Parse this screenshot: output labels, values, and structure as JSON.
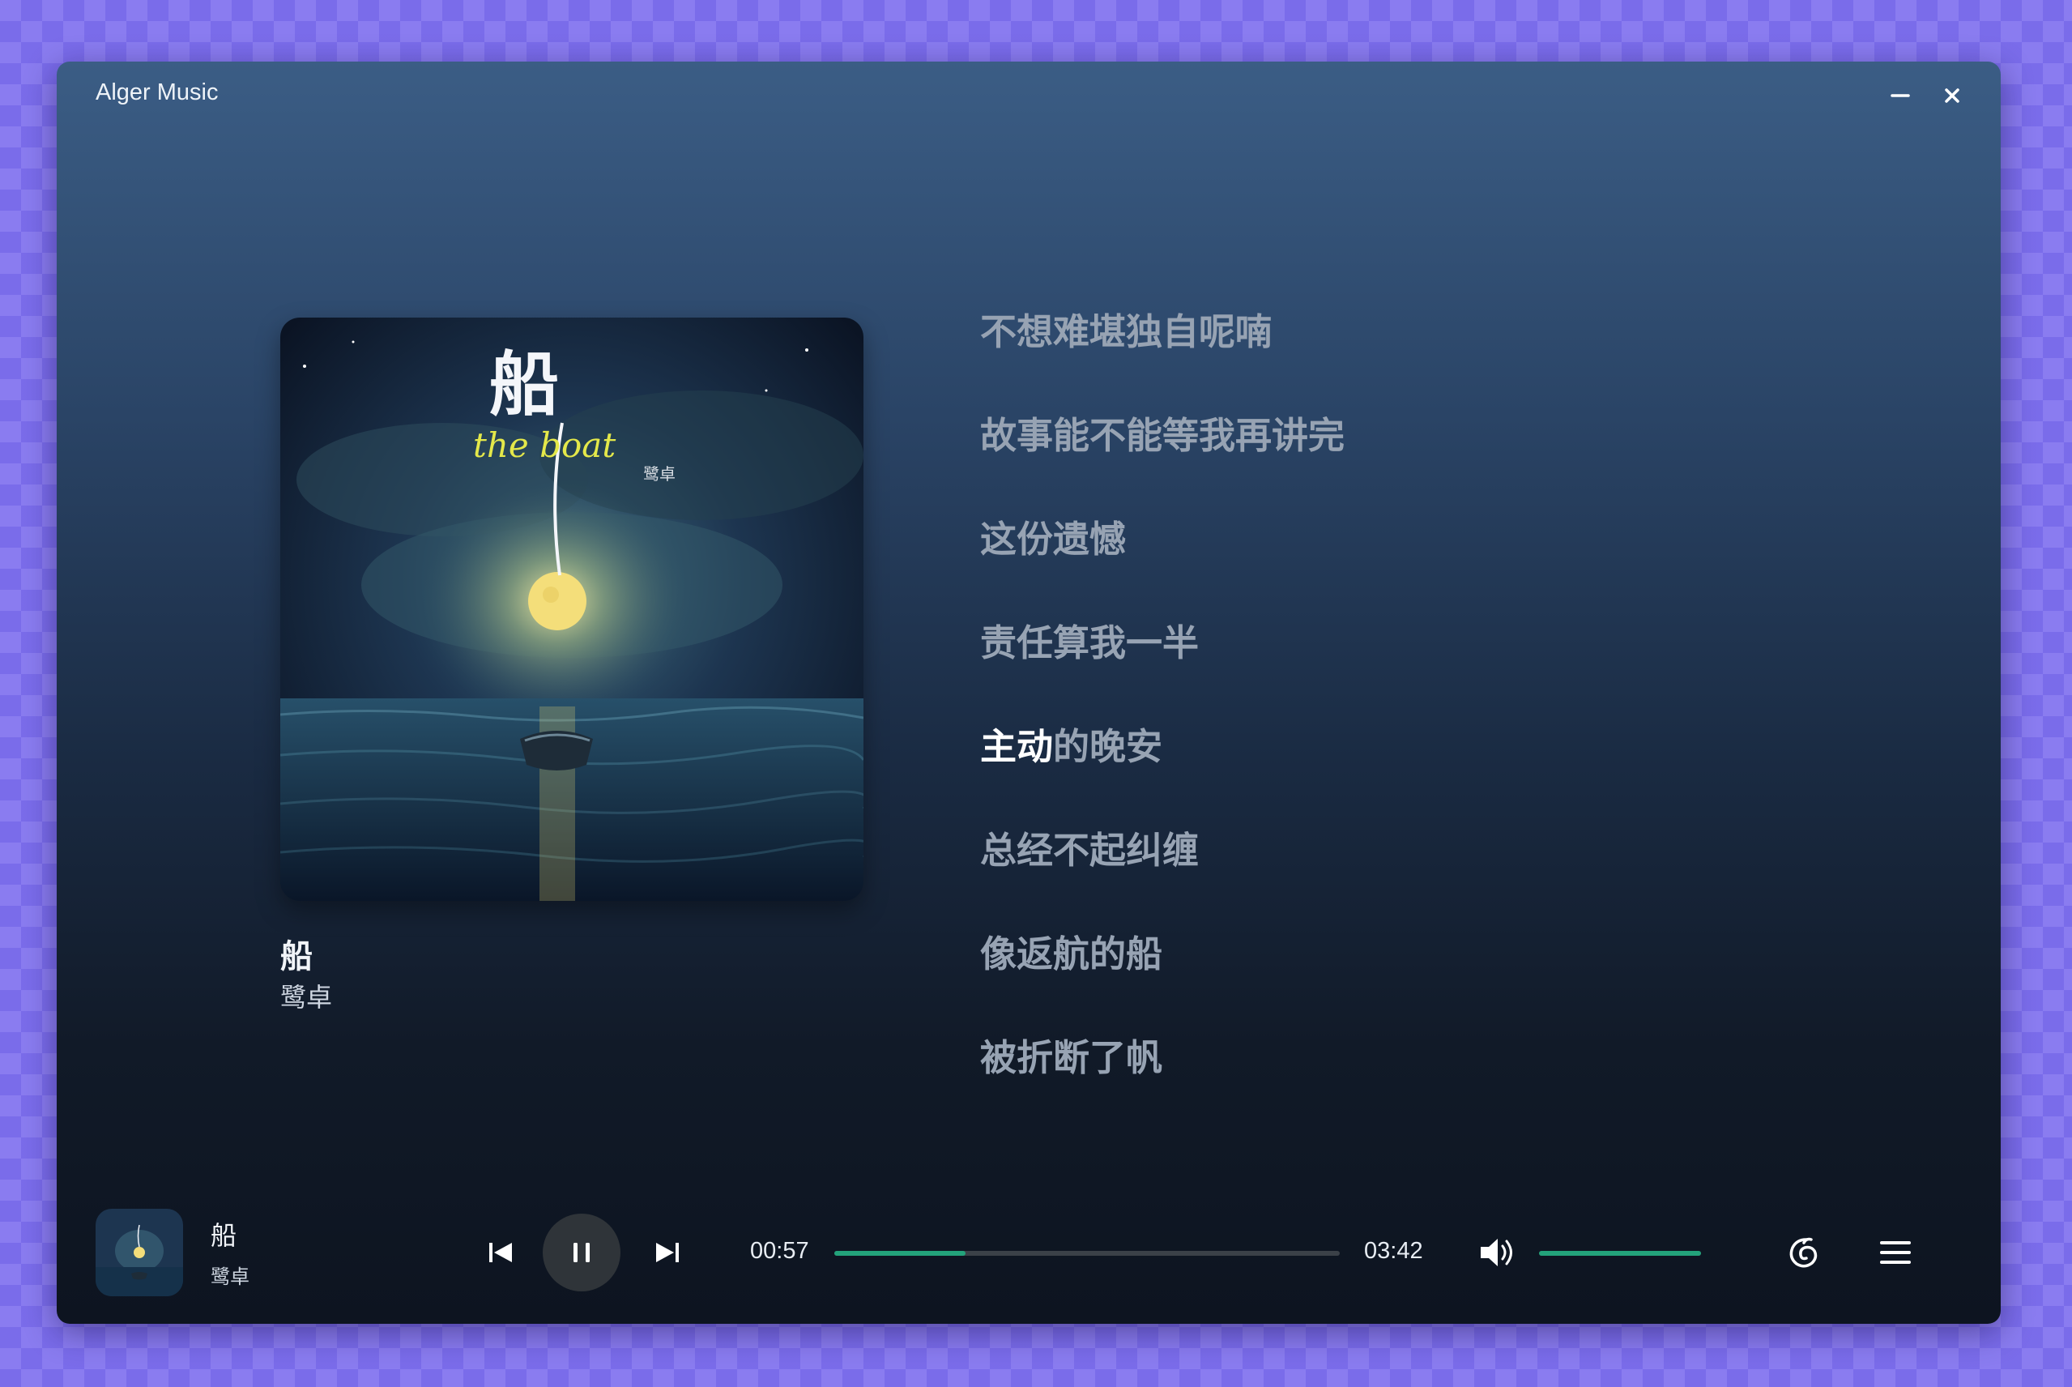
{
  "window": {
    "title": "Alger Music"
  },
  "song": {
    "title": "船",
    "artist": "鹭卓"
  },
  "cover_art": {
    "title_text": "船",
    "subtitle_text": "the boat",
    "artist_text": "鹭卓"
  },
  "lyrics": [
    {
      "sung": "",
      "unsung": "不想难堪独自呢喃"
    },
    {
      "sung": "",
      "unsung": "故事能不能等我再讲完"
    },
    {
      "sung": "",
      "unsung": "这份遗憾"
    },
    {
      "sung": "",
      "unsung": "责任算我一半"
    },
    {
      "sung": "主动",
      "unsung": "的晚安"
    },
    {
      "sung": "",
      "unsung": "总经不起纠缠"
    },
    {
      "sung": "",
      "unsung": "像返航的船"
    },
    {
      "sung": "",
      "unsung": "被折断了帆"
    }
  ],
  "player": {
    "title": "船",
    "artist": "鹭卓",
    "current_time": "00:57",
    "total_time": "03:42",
    "progress_fraction": 0.26,
    "volume_fraction": 1.0
  },
  "icons": {
    "minimize": "minimize-icon",
    "close": "close-icon",
    "previous": "previous-track-icon",
    "pause": "pause-icon",
    "next": "next-track-icon",
    "volume": "volume-icon",
    "netease": "netease-music-icon",
    "playlist": "playlist-menu-icon"
  },
  "colors": {
    "accent": "#23a37b",
    "lyric_inactive": "#97a3b3",
    "lyric_active": "#ffffff"
  }
}
